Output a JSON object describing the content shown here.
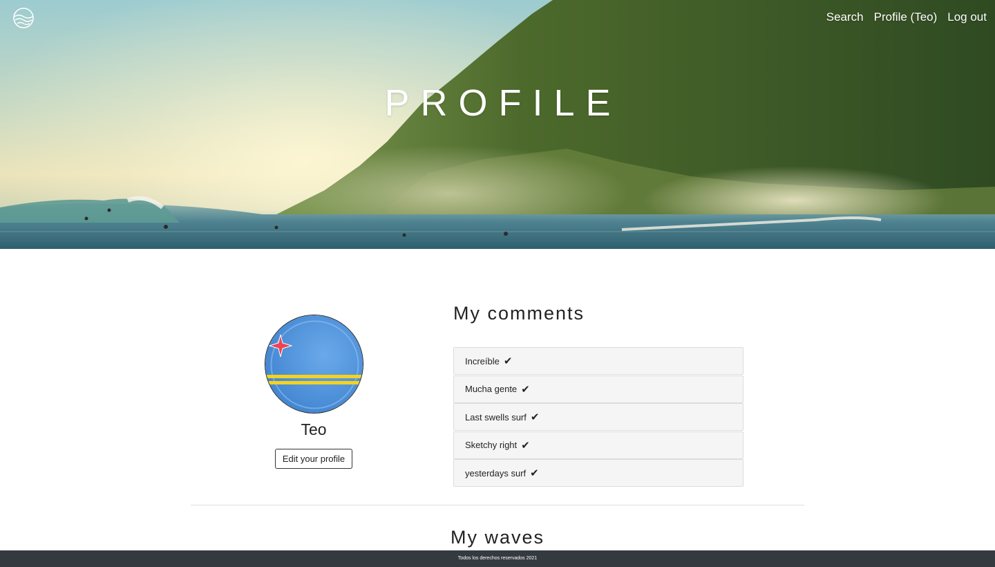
{
  "nav": {
    "logo": "wave-logo-icon",
    "links": [
      "Search",
      "Profile (Teo)",
      "Log out"
    ]
  },
  "hero": {
    "title": "PROFILE"
  },
  "profile": {
    "name": "Teo",
    "avatar_icon": "aruba-flag-avatar",
    "edit_label": "Edit your profile"
  },
  "comments": {
    "title": "My comments",
    "items": [
      {
        "text": "Increíble",
        "mark": "✔"
      },
      {
        "text": "Mucha gente",
        "mark": "✔"
      },
      {
        "text": "Last swells surf",
        "mark": "✔"
      },
      {
        "text": "Sketchy right",
        "mark": "✔"
      },
      {
        "text": "yesterdays surf",
        "mark": "✔"
      }
    ]
  },
  "waves": {
    "title": "My waves"
  },
  "footer": {
    "text": "Todos los derechos reservados 2021"
  },
  "colors": {
    "footer_bg": "#343a40",
    "flag_blue": "#4a8fd9",
    "flag_yellow": "#f5d31c",
    "flag_star": "#e94557"
  }
}
